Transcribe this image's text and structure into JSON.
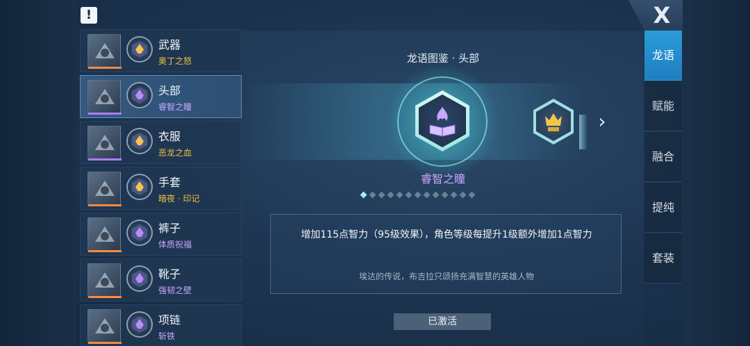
{
  "header": {
    "alert_icon": "!"
  },
  "close": {
    "label": "X",
    "icon": "close-icon"
  },
  "equipment": [
    {
      "slot": "武器",
      "rune": "奥丁之怒",
      "rune_color": "#f0c040",
      "rarity_color": "#ff8a3d",
      "hex_color": "#f3c54a",
      "icon": "weapon-icon"
    },
    {
      "slot": "头部",
      "rune": "睿智之瞳",
      "rune_color": "#c9a6ff",
      "rarity_color": "#b07cff",
      "hex_color": "#b98cf5",
      "icon": "helmet-icon"
    },
    {
      "slot": "衣服",
      "rune": "恶龙之血",
      "rune_color": "#f0c040",
      "rarity_color": "#b07cff",
      "hex_color": "#f3c54a",
      "icon": "armor-icon"
    },
    {
      "slot": "手套",
      "rune": "暗夜 · 印记",
      "rune_color": "#f0c040",
      "rarity_color": "#ff8a3d",
      "hex_color": "#f3c54a",
      "icon": "glove-icon"
    },
    {
      "slot": "裤子",
      "rune": "体质祝福",
      "rune_color": "#c9a6ff",
      "rarity_color": "#ff8a3d",
      "hex_color": "#b98cf5",
      "icon": "pants-icon"
    },
    {
      "slot": "靴子",
      "rune": "强韧之壁",
      "rune_color": "#c9a6ff",
      "rarity_color": "#ff8a3d",
      "hex_color": "#b98cf5",
      "icon": "boots-icon"
    },
    {
      "slot": "项链",
      "rune": "斩铁",
      "rune_color": "#c9a6ff",
      "rarity_color": "#ff8a3d",
      "hex_color": "#b98cf5",
      "icon": "necklace-icon"
    }
  ],
  "detail": {
    "title": "龙语图鉴 · 头部",
    "rune_name": "睿智之瞳",
    "effect": "增加115点智力（95级效果），角色等级每提升1级额外增加1点智力",
    "lore": "埃达的传说，布吉拉只颂扬充满智慧的英雄人物",
    "status": "已激活",
    "page_count": 13,
    "active_page": 1,
    "main_icon": "book-flame-icon",
    "next_icon": "crown-rune-icon"
  },
  "tabs": [
    {
      "label": "龙语",
      "active": true
    },
    {
      "label": "赋能",
      "active": false
    },
    {
      "label": "融合",
      "active": false
    },
    {
      "label": "提纯",
      "active": false
    },
    {
      "label": "套装",
      "active": false
    }
  ]
}
